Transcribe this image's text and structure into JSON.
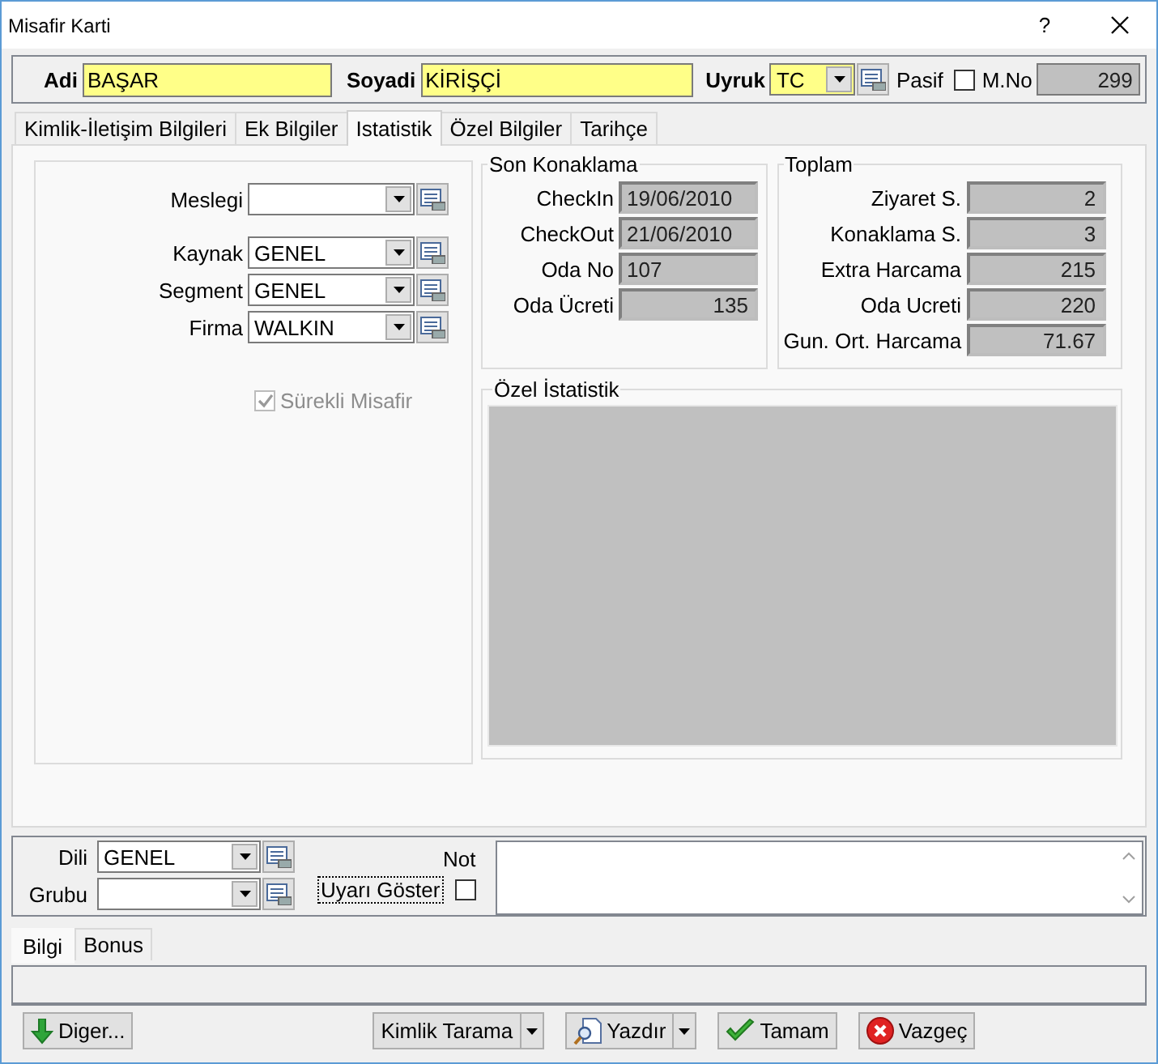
{
  "window": {
    "title": "Misafir Karti",
    "help": "?"
  },
  "header": {
    "name": {
      "label": "Adi",
      "value": "BAŞAR"
    },
    "surname": {
      "label": "Soyadi",
      "value": "KİRİŞÇİ"
    },
    "nationality": {
      "label": "Uyruk",
      "value": "TC"
    },
    "passive": {
      "label": "Pasif",
      "checked": false
    },
    "number": {
      "label": "M.No",
      "value": "299"
    }
  },
  "tabs": [
    {
      "label": "Kimlik-İletişim Bilgileri",
      "selected": false
    },
    {
      "label": "Ek Bilgiler",
      "selected": false
    },
    {
      "label": "Istatistik",
      "selected": true
    },
    {
      "label": "Özel Bilgiler",
      "selected": false
    },
    {
      "label": "Tarihçe",
      "selected": false
    }
  ],
  "statistics": {
    "lookups": [
      {
        "label": "Meslegi"
      },
      {
        "label": "Kaynak",
        "value": "GENEL"
      },
      {
        "label": "Segment",
        "value": "GENEL"
      },
      {
        "label": "Firma",
        "value": "WALKIN"
      }
    ],
    "regular_guest": {
      "label": "Sürekli Misafir",
      "checked": true,
      "disabled": true
    },
    "last_stay": {
      "title": "Son Konaklama",
      "rows": [
        {
          "label": "CheckIn",
          "value": "19/06/2010",
          "kind": "text"
        },
        {
          "label": "CheckOut",
          "value": "21/06/2010",
          "kind": "text"
        },
        {
          "label": "Oda No",
          "value": "107",
          "kind": "text"
        },
        {
          "label": "Oda Ücreti",
          "value": "135",
          "kind": "number"
        }
      ]
    },
    "totals": {
      "title": "Toplam",
      "rows": [
        {
          "label": "Ziyaret S.",
          "value": "2",
          "kind": "number"
        },
        {
          "label": "Konaklama S.",
          "value": "3",
          "kind": "number"
        },
        {
          "label": "Extra Harcama",
          "value": "215",
          "kind": "number"
        },
        {
          "label": "Oda Ucreti",
          "value": "220",
          "kind": "number"
        },
        {
          "label": "Gun. Ort. Harcama",
          "value": "71.67",
          "kind": "number"
        }
      ]
    },
    "special": {
      "title": "Özel İstatistik"
    }
  },
  "footer": {
    "lookups": [
      {
        "label": "Dili",
        "value": "GENEL"
      },
      {
        "label": "Grubu"
      }
    ],
    "note": {
      "label": "Not"
    },
    "show_warning": {
      "label": "Uyarı Göster",
      "checked": false
    }
  },
  "bottom_tabs": [
    {
      "label": "Bilgi",
      "selected": true
    },
    {
      "label": "Bonus",
      "selected": false
    }
  ],
  "buttons": [
    {
      "label": "Diger...",
      "kind": "more"
    },
    {
      "label": "Kimlik Tarama",
      "kind": "scan"
    },
    {
      "label": "Yazdır",
      "kind": "print"
    },
    {
      "label": "Tamam",
      "kind": "confirm"
    },
    {
      "label": "Vazgeç",
      "kind": "cancel"
    }
  ]
}
